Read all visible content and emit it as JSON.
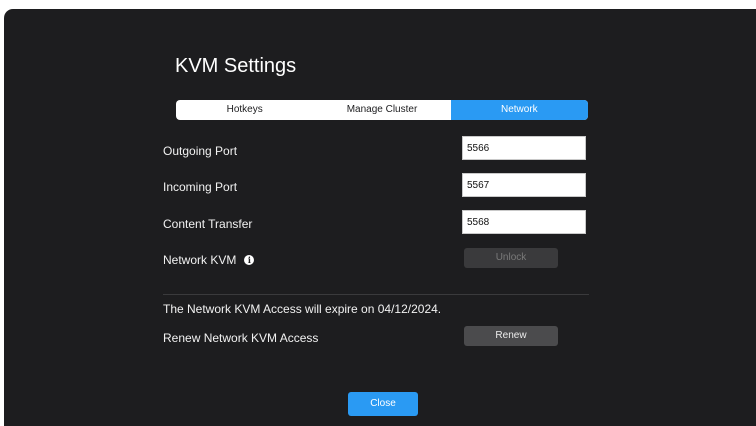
{
  "title": "KVM Settings",
  "tabs": [
    {
      "label": "Hotkeys"
    },
    {
      "label": "Manage Cluster"
    },
    {
      "label": "Network"
    }
  ],
  "fields": {
    "outgoing": {
      "label": "Outgoing Port",
      "value": "5566"
    },
    "incoming": {
      "label": "Incoming Port",
      "value": "5567"
    },
    "content": {
      "label": "Content Transfer",
      "value": "5568"
    }
  },
  "network_kvm": {
    "label": "Network KVM",
    "icon": "info-icon",
    "button": "Unlock"
  },
  "expiry_text": "The Network KVM Access will expire on 04/12/2024.",
  "renew": {
    "label": "Renew Network KVM Access",
    "button": "Renew"
  },
  "close_button": "Close",
  "colors": {
    "accent": "#2a9af3",
    "background": "#1d1d1f"
  }
}
